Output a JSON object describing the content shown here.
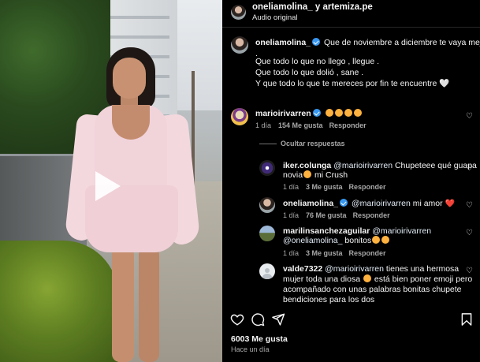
{
  "header": {
    "title": "oneliamolina_ y artemiza.pe",
    "subtitle": "Audio original"
  },
  "caption": {
    "username": "oneliamolina_",
    "line1": "Que de noviembre a diciembre te vaya mejor",
    "line2": ".",
    "line3": "Que todo lo que no llego , llegue .",
    "line4": "Que todo lo que dolió , sane .",
    "line5": "Y que todo lo que te mereces por fin te encuentre 🤍"
  },
  "comments": [
    {
      "username": "marioirivarren",
      "emoji_count": 4,
      "time": "1 día",
      "likes": "154 Me gusta",
      "reply": "Responder"
    }
  ],
  "hide_replies": "Ocultar respuestas",
  "replies": [
    {
      "username": "iker.colunga",
      "mention": "@marioirivarren",
      "text1": "Chupeteee qué guapa",
      "text2": "novia",
      "text2_tail": " mi Crush",
      "time": "1 día",
      "likes": "3 Me gusta",
      "reply": "Responder"
    },
    {
      "username": "oneliamolina_",
      "mention": "@marioirivarren",
      "text": "mi amor",
      "heart": "❤️",
      "time": "1 día",
      "likes": "76 Me gusta",
      "reply": "Responder"
    },
    {
      "username": "marilinsanchezaguilar",
      "mention": "@marioirivarren",
      "mention2": "@oneliamolina_",
      "text": "bonitos",
      "time": "1 día",
      "likes": "3 Me gusta",
      "reply": "Responder"
    },
    {
      "username": "valde7322",
      "mention": "@marioirivarren",
      "text1": "tienes una hermosa",
      "text2a": "mujer toda una diosa",
      "text2b": " está bien poner emoji pero",
      "text3": "acompañado con unas palabras bonitas chupete",
      "text4": "bendiciones para los dos"
    }
  ],
  "footer": {
    "likes": "6003 Me gusta",
    "time_ago": "Hace un día"
  },
  "icons": {
    "like": "heart-outline-icon",
    "comment": "comment-bubble-icon",
    "share": "paper-plane-icon",
    "save": "bookmark-icon",
    "play": "play-icon",
    "verified": "verified-badge-icon"
  },
  "colors": {
    "background": "#000000",
    "muted_text": "#a8a8a8",
    "verified": "#3897f0",
    "heart": "#e3343f"
  }
}
